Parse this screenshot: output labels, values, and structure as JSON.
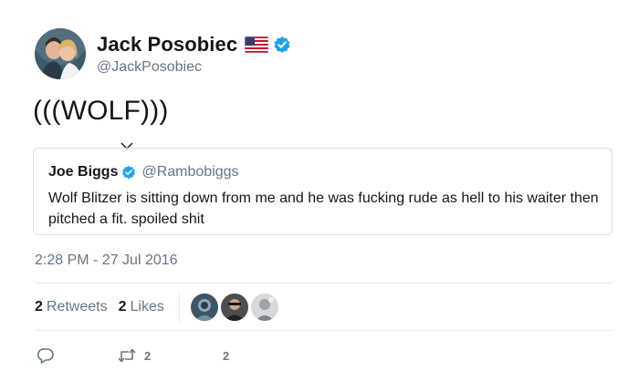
{
  "tweet": {
    "author": {
      "display_name": "Jack Posobiec",
      "handle": "@JackPosobiec",
      "flag_icon": "us-flag-icon",
      "verified_icon": "verified-badge-icon"
    },
    "text": "(((WOLF)))",
    "quoted": {
      "display_name": "Joe Biggs",
      "handle": "@Rambobiggs",
      "text": "Wolf Blitzer is sitting down from me and he was fucking rude as hell to his waiter then pitched a fit. spoiled shit"
    },
    "timestamp": "2:28 PM - 27 Jul 2016",
    "stats": {
      "retweets_count": "2",
      "retweets_label": "Retweets",
      "likes_count": "2",
      "likes_label": "Likes"
    },
    "actions": {
      "reply_icon": "reply-icon",
      "retweet_icon": "retweet-icon",
      "retweet_count": "2",
      "like_icon": "like-icon",
      "like_count": "2"
    }
  },
  "colors": {
    "text": "#14171a",
    "secondary": "#657786",
    "verified": "#1da1f2",
    "border": "#e6ecf0"
  }
}
